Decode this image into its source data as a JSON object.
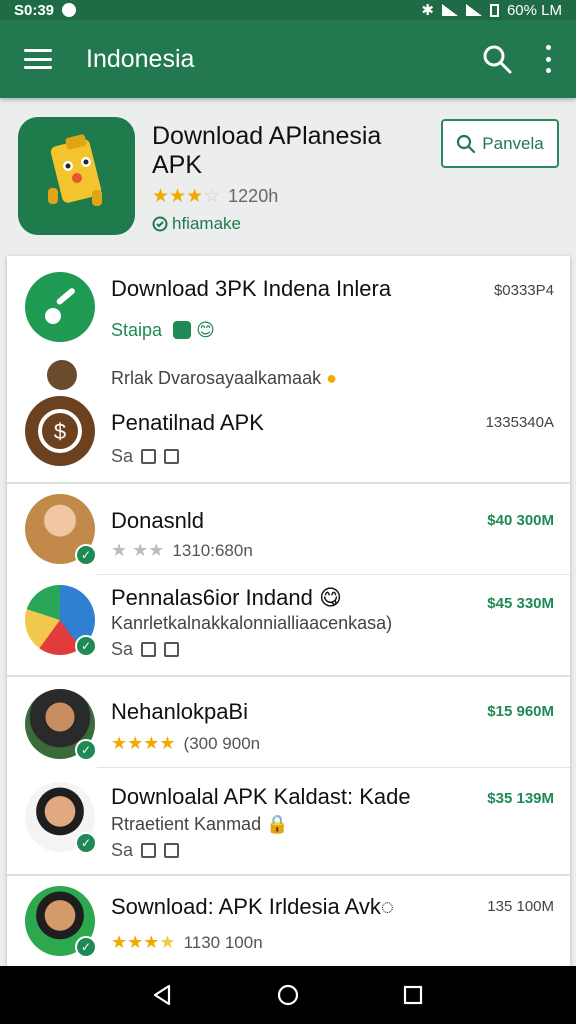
{
  "status_bar": {
    "time": "S0:39",
    "battery": "60% LM"
  },
  "app_bar": {
    "title": "Indonesia"
  },
  "header": {
    "title": "Download APlanesia APK",
    "rating_count": "1220h",
    "badge": "hfiamake",
    "button_label": "Panvela"
  },
  "rows": [
    {
      "title": "Download 3PK Indena Inlera",
      "price": "$0333P4",
      "sub": "Staipa"
    },
    {
      "sub": "Rrlak Dvarosayaalkamaak"
    },
    {
      "title": "Penatilnad APK",
      "price": "1335340A",
      "actions": "Sa"
    },
    {
      "title": "Donasnld",
      "price": "$40 300M",
      "rating_count": "1310:680n"
    },
    {
      "title": "Pennalas6ior Indand",
      "price": "$45 330M",
      "sub": "Kanrletkalnakkalonnialliaacenkasa)",
      "actions": "Sa"
    },
    {
      "title": "NehanlokpaBi",
      "price": "$15 960M",
      "rating_count": "(300 900n"
    },
    {
      "title": "Downloalal APK Kaldast: Kade",
      "price": "$35 139M",
      "sub": "Rtraetient Kanmad",
      "actions": "Sa"
    },
    {
      "title": "Sownload: APK Irldesia Avk",
      "price": "135 100M",
      "rating_count": "1130 100n"
    }
  ],
  "icons": {
    "menu": "menu-icon",
    "search": "search-icon",
    "more": "more-vert-icon",
    "back": "back-icon",
    "home": "home-icon",
    "recents": "recents-icon"
  },
  "colors": {
    "primary": "#23794f",
    "accent_green": "#1f8a55",
    "star": "#f2a900"
  }
}
